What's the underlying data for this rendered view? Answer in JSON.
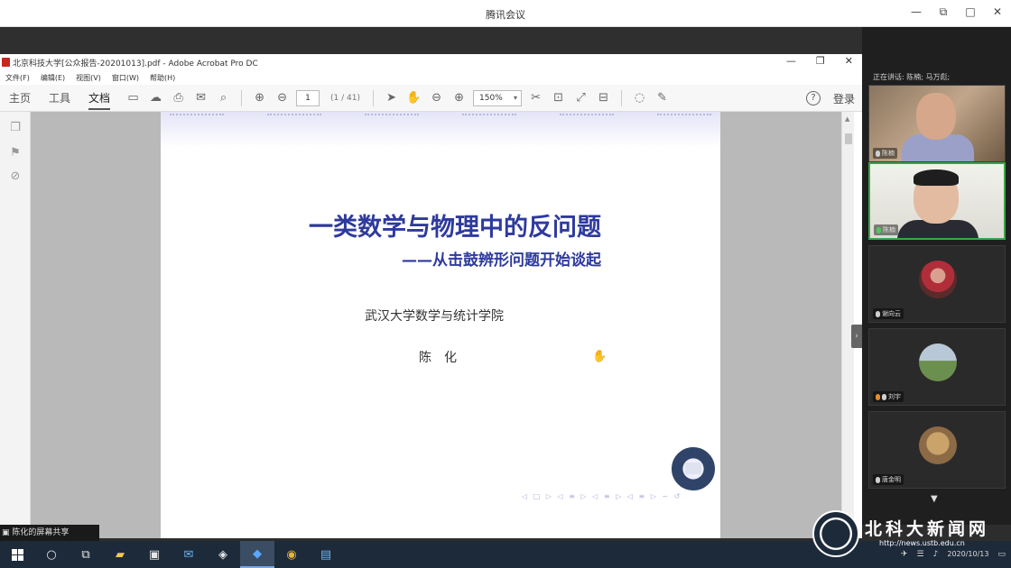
{
  "meeting": {
    "title": "腾讯会议",
    "controls": [
      "—",
      "⧉",
      "□",
      "✕"
    ]
  },
  "acrobat": {
    "window_title": "北京科技大学[公众报告-20201013].pdf - Adobe Acrobat Pro DC",
    "window_controls": [
      "—",
      "❐",
      "✕"
    ],
    "menu": [
      "文件(F)",
      "编辑(E)",
      "视图(V)",
      "窗口(W)",
      "帮助(H)"
    ],
    "tabs": [
      "主页",
      "工具",
      "文档"
    ],
    "active_tab": "文档",
    "page_number": "1",
    "page_count": "(1 / 41)",
    "zoom": "150%",
    "login": "登录",
    "help": "?"
  },
  "slide": {
    "title": "一类数学与物理中的反问题",
    "subtitle": "——从击鼓辨形问题开始谈起",
    "institution": "武汉大学数学与统计学院",
    "author": "陈　化"
  },
  "video_panel": {
    "speaking_label": "正在讲话: 陈楠; 马万彪;",
    "tiles": [
      {
        "name": "陈楠",
        "kind": "video-man-older"
      },
      {
        "name": "陈楠",
        "kind": "video-man-glasses",
        "active": true
      },
      {
        "name": "谢向云",
        "kind": "avatar"
      },
      {
        "name": "刘宇",
        "kind": "avatar"
      },
      {
        "name": "唐金明",
        "kind": "avatar"
      }
    ]
  },
  "share_label": "陈化的屏幕共享",
  "taskbar": {
    "clock_time": "",
    "clock_date": "2020/10/13"
  },
  "watermark": {
    "text": "北科大新闻网",
    "url": "http://news.ustb.edu.cn"
  }
}
